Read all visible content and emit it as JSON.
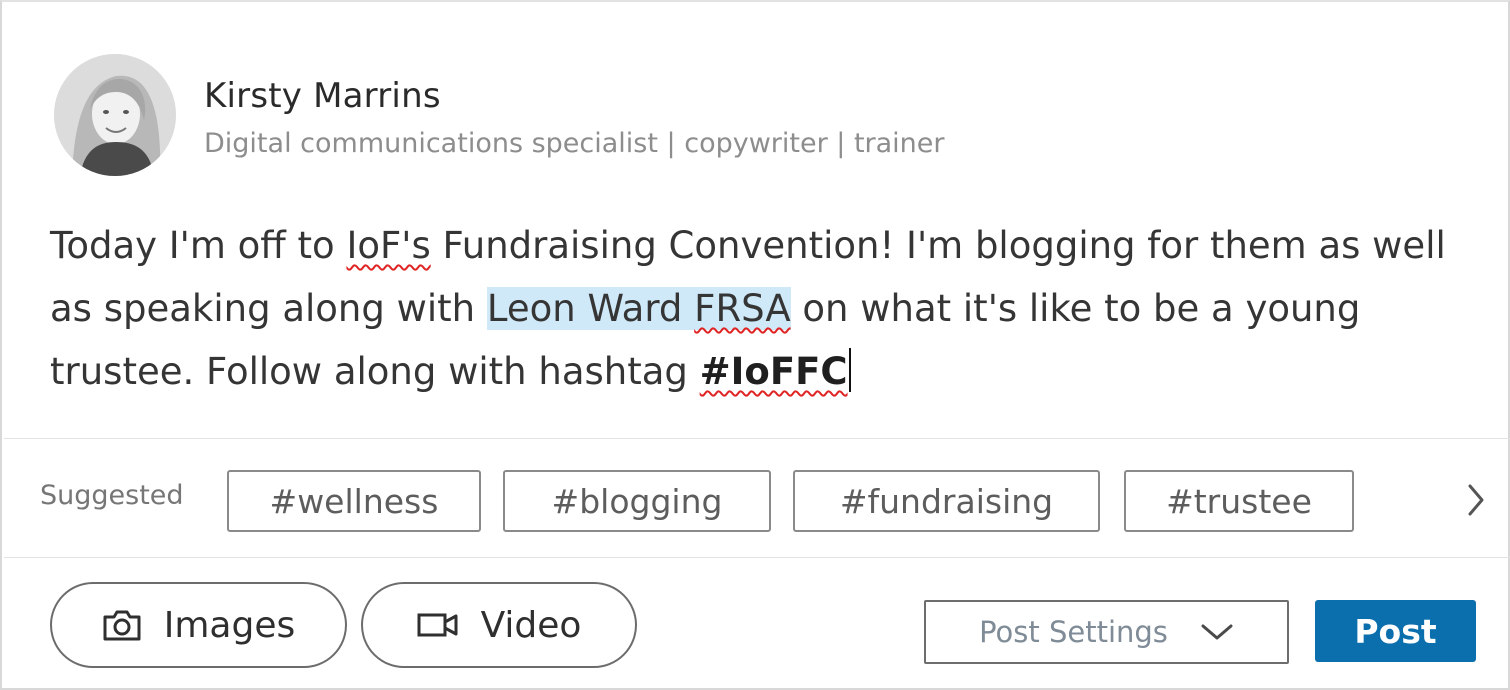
{
  "author": {
    "name": "Kirsty Marrins",
    "headline": "Digital communications specialist | copywriter | trainer"
  },
  "composer": {
    "text_1": "Today I'm off to ",
    "text_2": "IoF's",
    "text_3": " Fundraising Convention! I'm blogging for them as well as speaking along with ",
    "mention_first": "Leon Ward ",
    "mention_last": "FRSA",
    "text_4": " on what it's like to be a young trustee. Follow along with hashtag ",
    "hashtag": "#IoFFC"
  },
  "suggested": {
    "label": "Suggested",
    "tags": [
      "#wellness",
      "#blogging",
      "#fundraising",
      "#trustee"
    ],
    "more_icon": "chevron-right-icon"
  },
  "actions": {
    "images_label": "Images",
    "images_icon": "camera-icon",
    "video_label": "Video",
    "video_icon": "video-camera-icon",
    "settings_label": "Post Settings",
    "settings_icon": "chevron-down-icon",
    "post_label": "Post"
  },
  "colors": {
    "post_button": "#0b6fae",
    "mention_highlight": "#cfe9f8",
    "spellcheck": "#e02424"
  }
}
